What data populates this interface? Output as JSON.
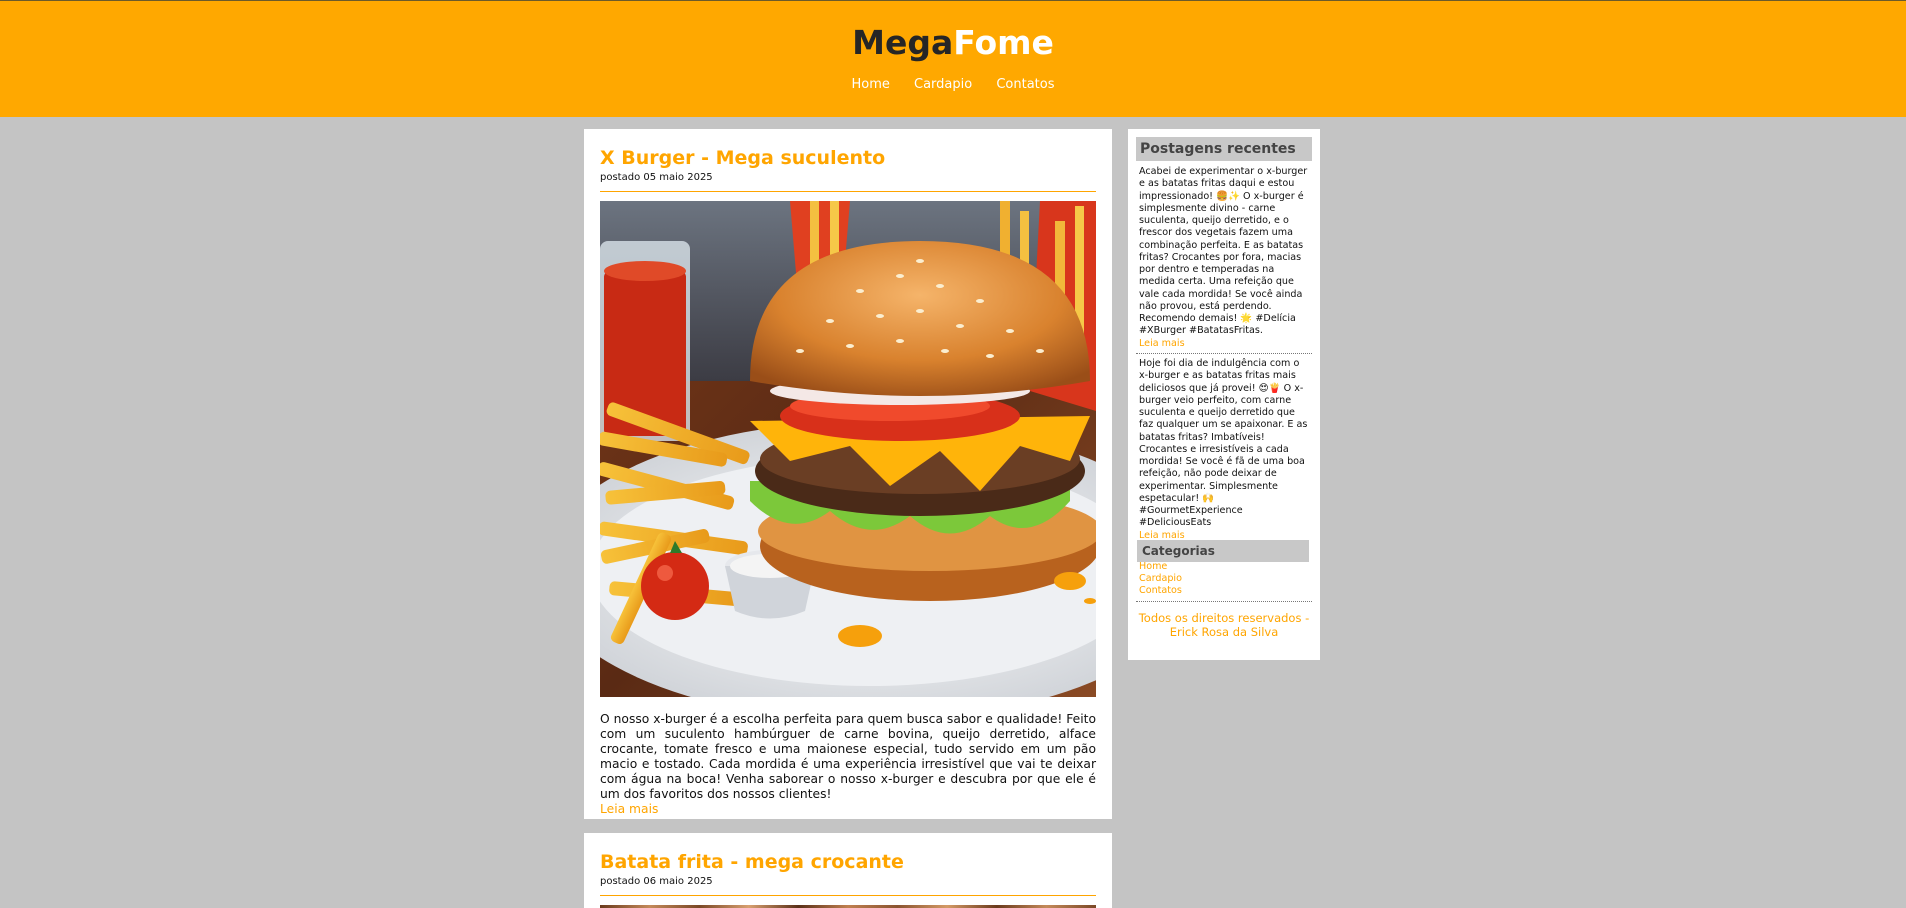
{
  "site": {
    "logo_part1": "Mega",
    "logo_part2": "Fome",
    "nav": [
      "Home",
      "Cardapio",
      "Contatos"
    ],
    "brand_color": "#ffa800",
    "bg_color": "#c4c4c4"
  },
  "posts": [
    {
      "title": "X Burger - Mega suculento",
      "date": "postado 05 maio 2025",
      "text": "O nosso x-burger é a escolha perfeita para quem busca sabor e qualidade! Feito com um suculento hambúrguer de carne bovina, queijo derretido, alface crocante, tomate fresco e uma maionese especial, tudo servido em um pão macio e tostado. Cada mordida é uma experiência irresistível que vai te deixar com água na boca! Venha saborear o nosso x-burger e descubra por que ele é um dos favoritos dos nossos clientes!",
      "read_more": "Leia mais"
    },
    {
      "title": "Batata frita - mega crocante",
      "date": "postado 06 maio 2025"
    }
  ],
  "sidebar": {
    "recent_title": "Postagens recentes",
    "recent": [
      {
        "text": "Acabei de experimentar o x-burger e as batatas fritas daqui e estou impressionado! 🍔✨ O x-burger é simplesmente divino - carne suculenta, queijo derretido, e o frescor dos vegetais fazem uma combinação perfeita. E as batatas fritas? Crocantes por fora, macias por dentro e temperadas na medida certa. Uma refeição que vale cada mordida! Se você ainda não provou, está perdendo. Recomendo demais! 🌟 #Delícia #XBurger #BatatasFritas.",
        "more": "Leia mais"
      },
      {
        "text": "Hoje foi dia de indulgência com o x-burger e as batatas fritas mais deliciosos que já provei! 😍🍟 O x-burger veio perfeito, com carne suculenta e queijo derretido que faz qualquer um se apaixonar. E as batatas fritas? Imbatíveis! Crocantes e irresistíveis a cada mordida! Se você é fã de uma boa refeição, não pode deixar de experimentar. Simplesmente espetacular! 🙌 #GourmetExperience #DeliciousEats",
        "more": "Leia mais"
      }
    ],
    "categories_title": "Categorias",
    "categories": [
      "Home",
      "Cardapio",
      "Contatos"
    ],
    "footer": "Todos os direitos reservados - Erick Rosa da Silva"
  }
}
